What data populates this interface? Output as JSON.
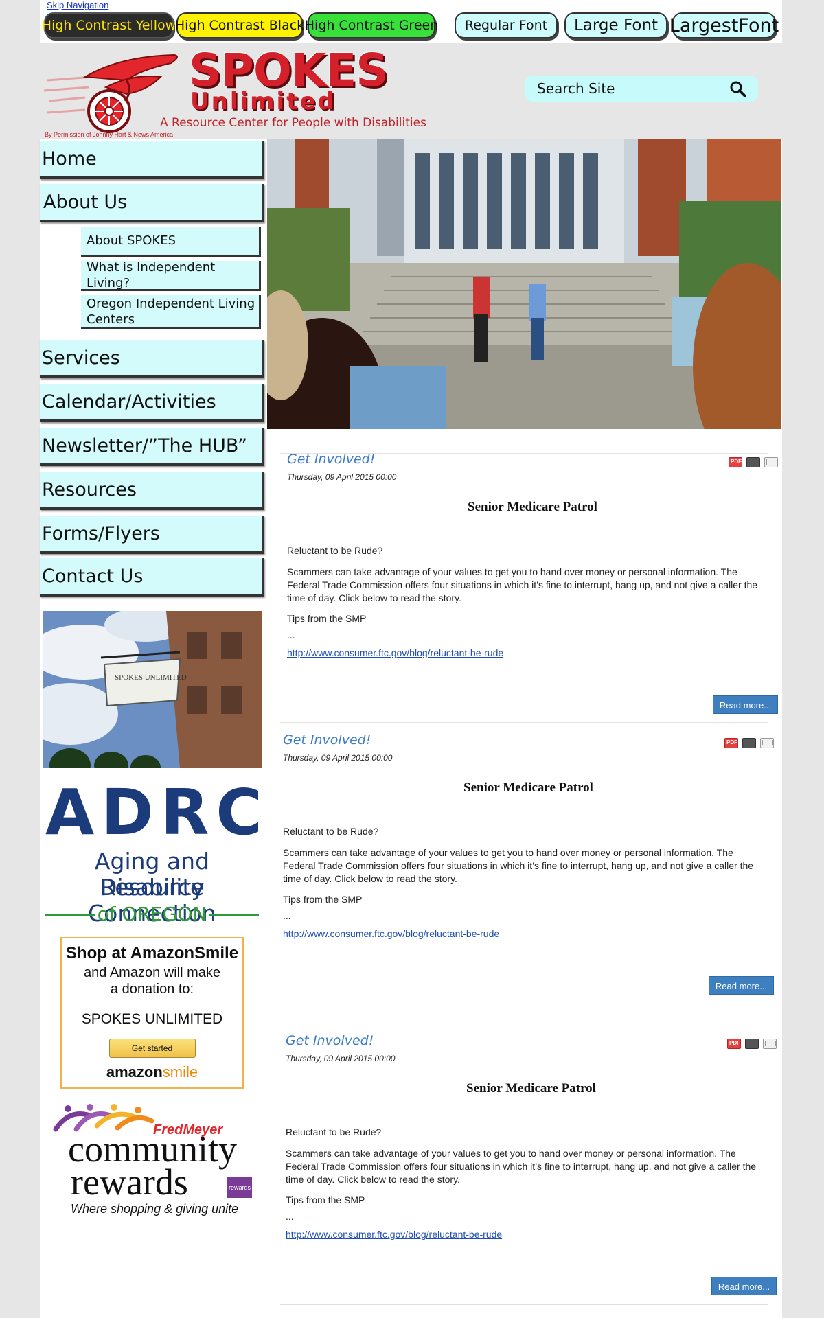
{
  "accessibility": {
    "skip_nav": "Skip Navigation",
    "contrast_buttons": [
      "High Contrast Yellow",
      "High Contrast Black",
      "High Contrast Green"
    ],
    "font_buttons": [
      "Regular Font",
      "Large Font",
      "LargestFont"
    ]
  },
  "header": {
    "brand_line1": "SPOKES",
    "brand_line2": "Unlimited",
    "tagline": "A Resource Center for People with Disabilities",
    "credit": "By Permission of Johnny Hart & News America",
    "search_placeholder": "Search Site",
    "colors": {
      "brand_red": "#d3202a",
      "nav_cyan": "#d4fbfb",
      "link_blue": "#3d7dc6"
    }
  },
  "nav": {
    "items": [
      "Home",
      "About Us",
      "Services",
      "Calendar/Activities",
      "Newsletter/”The HUB”",
      "Resources",
      "Forms/Flyers",
      "Contact Us"
    ],
    "subitems": [
      "About SPOKES",
      "What is Independent Living?",
      "Oregon Independent Living Centers"
    ]
  },
  "promos": {
    "sign_text": "SPOKES UNLIMITED",
    "adrc": {
      "big": "ADRC",
      "line1": "Aging and Disability",
      "line2": "Resource Connection",
      "line3": "of OREGON"
    },
    "amazon": {
      "title": "Shop at AmazonSmile",
      "line1": "and Amazon will make",
      "line2": "a donation to:",
      "org": "SPOKES UNLIMITED",
      "button": "Get started",
      "logo_a": "amazon",
      "logo_b": "smile"
    },
    "fredmeyer": {
      "brand": "FredMeyer",
      "line1": "community",
      "line2": "rewards",
      "badge": "rewards",
      "tag": "Where shopping & giving unite"
    }
  },
  "articles": [
    {
      "category": "Get Involved!",
      "date": "Thursday, 09 April 2015 00:00",
      "heading": "Senior Medicare Patrol",
      "lead": "Reluctant to be Rude?",
      "body": "Scammers can take advantage of your values to get you to hand over money or personal information. The Federal Trade Commission offers four situations in which it’s fine to interrupt, hang up, and not give a caller the time of day. Click below to read the story.",
      "tips": "Tips from the SMP",
      "ellipsis": "...",
      "link": "http://www.consumer.ftc.gov/blog/reluctant-be-rude",
      "read_more": "Read more..."
    },
    {
      "category": "Get Involved!",
      "date": "Thursday, 09 April 2015 00:00",
      "heading": "Senior Medicare Patrol",
      "lead": "Reluctant to be Rude?",
      "body": "Scammers can take advantage of your values to get you to hand over money or personal information. The Federal Trade Commission offers four situations in which it’s fine to interrupt, hang up, and not give a caller the time of day. Click below to read the story.",
      "tips": "Tips from the SMP",
      "ellipsis": "...",
      "link": "http://www.consumer.ftc.gov/blog/reluctant-be-rude",
      "read_more": "Read more..."
    },
    {
      "category": "Get Involved!",
      "date": "Thursday, 09 April 2015 00:00",
      "heading": "Senior Medicare Patrol",
      "lead": "Reluctant to be Rude?",
      "body": "Scammers can take advantage of your values to get you to hand over money or personal information. The Federal Trade Commission offers four situations in which it’s fine to interrupt, hang up, and not give a caller the time of day. Click below to read the story.",
      "tips": "Tips from the SMP",
      "ellipsis": "...",
      "link": "http://www.consumer.ftc.gov/blog/reluctant-be-rude",
      "read_more": "Read more..."
    }
  ]
}
